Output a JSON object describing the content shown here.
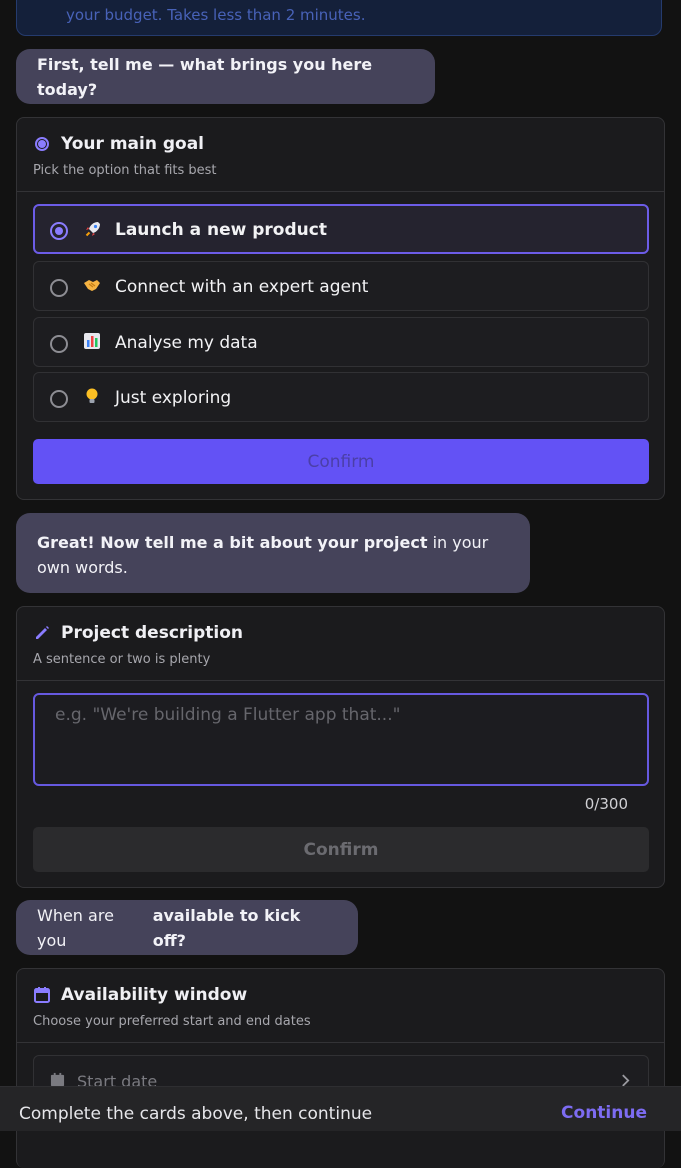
{
  "intro": {
    "text": "your budget. Takes less than 2 minutes."
  },
  "messages": [
    {
      "text": "First, tell me — what brings you here today?"
    },
    {
      "text_bold": "Great! Now tell me a bit about your project",
      "text_rest": " in your own words."
    },
    {
      "text_a": "When are you ",
      "text_b": "available to kick off?"
    }
  ],
  "goal_card": {
    "title": "Your main goal",
    "subtitle": "Pick the option that fits best",
    "options": [
      {
        "label": "Launch a new product",
        "icon": "rocket-icon",
        "selected": true
      },
      {
        "label": "Connect with an expert agent",
        "icon": "handshake-icon",
        "selected": false
      },
      {
        "label": "Analyse my data",
        "icon": "bar-chart-icon",
        "selected": false
      },
      {
        "label": "Just exploring",
        "icon": "lightbulb-icon",
        "selected": false
      }
    ],
    "confirm_label": "Confirm"
  },
  "project_card": {
    "title": "Project description",
    "subtitle": "A sentence or two is plenty",
    "placeholder": "e.g. \"We're building a Flutter app that...\"",
    "counter": "0/300",
    "confirm_label": "Confirm"
  },
  "availability_card": {
    "title": "Availability window",
    "subtitle": "Choose your preferred start and end dates",
    "start_placeholder": "Start date"
  },
  "footer": {
    "message": "Complete the cards above, then continue",
    "continue_label": "Continue"
  },
  "colors": {
    "accent": "#6352f5",
    "bubble": "#45435a",
    "card": "#1b1b1d",
    "background": "#121212"
  }
}
